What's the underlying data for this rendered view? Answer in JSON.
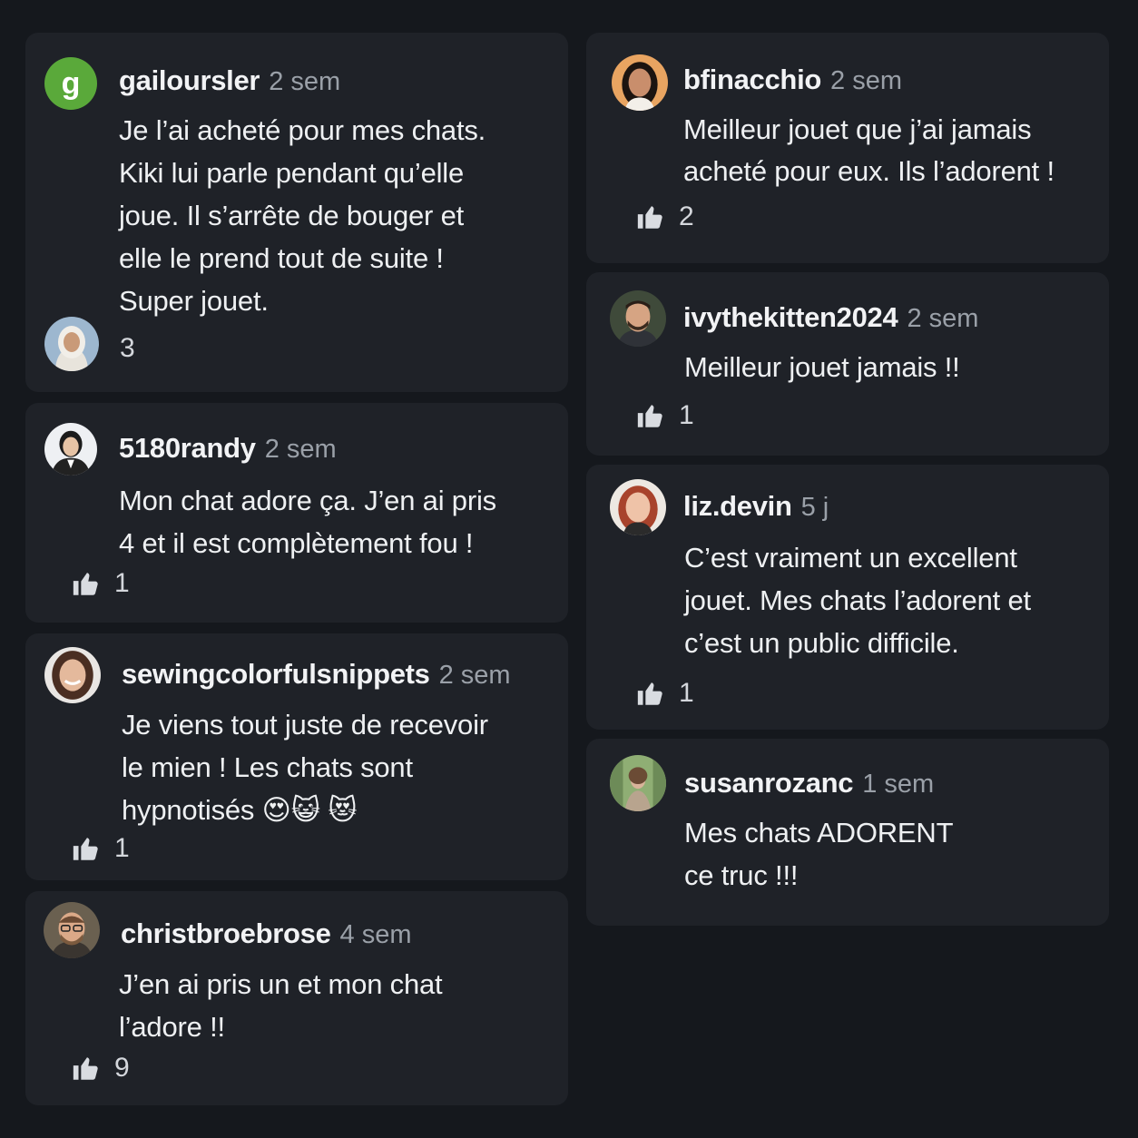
{
  "comments": [
    {
      "username": "gailoursler",
      "time": "2 sem",
      "avatar_letter": "g",
      "text": "Je l’ai acheté pour mes chats.\nKiki lui parle pendant qu’elle\njoue. Il s’arrête de bouger et\nelle le prend tout de suite !\nSuper jouet.",
      "likes": "3"
    },
    {
      "username": "5180randy",
      "time": "2 sem",
      "text": "Mon chat adore ça. J’en ai pris\n4 et il est complètement fou !",
      "likes": "1"
    },
    {
      "username": "sewingcolorfulsnippets",
      "time": "2 sem",
      "text": "Je viens tout juste de recevoir\nle mien ! Les chats sont\nhypnotisés 😍😺 😻",
      "likes": "1"
    },
    {
      "username": "christbroebrose",
      "time": "4 sem",
      "text": "J’en ai pris un et mon chat\nl’adore !!",
      "likes": "9"
    },
    {
      "username": "bfinacchio",
      "time": "2 sem",
      "text": "Meilleur jouet que j’ai jamais\nacheté pour eux. Ils l’adorent !",
      "likes": "2"
    },
    {
      "username": "ivythekitten2024",
      "time": "2 sem",
      "text": "Meilleur jouet jamais !!",
      "likes": "1"
    },
    {
      "username": "liz.devin",
      "time": "5 j",
      "text": "C’est vraiment un excellent\njouet. Mes chats l’adorent et\nc’est un public difficile.",
      "likes": "1"
    },
    {
      "username": "susanrozanc",
      "time": "1 sem",
      "text": "Mes chats ADORENT\nce truc !!!"
    }
  ],
  "colors": {
    "background": "#15181d",
    "card": "#1f2228",
    "accent_avatar": "#5aa93a"
  },
  "icons": {
    "like": "thumbs-up-icon"
  }
}
